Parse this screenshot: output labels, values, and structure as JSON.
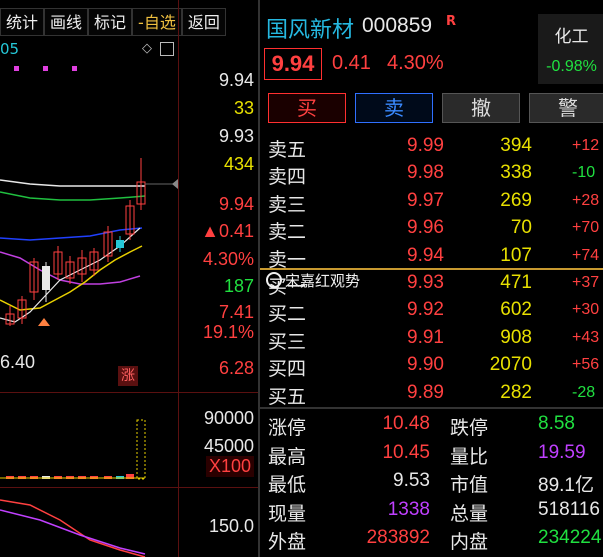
{
  "toolbar": {
    "items": [
      "统计",
      "画线",
      "标记",
      "-自选",
      "返回"
    ]
  },
  "chart_axis": {
    "top_code": "05",
    "price_right": [
      "9.94",
      "33",
      "9.93",
      "434",
      "9.94",
      "▲0.41",
      "4.30%",
      "187",
      "7.41",
      "19.1%",
      "6.28"
    ],
    "low_label": "6.40",
    "zhang": "涨",
    "volume_ticks": [
      "90000",
      "45000",
      "X100"
    ],
    "bottom_tick": "150.0"
  },
  "stock": {
    "name": "国风新材",
    "code": "000859",
    "badge": "R",
    "price": "9.94",
    "change": "0.41",
    "change_pct": "4.30%"
  },
  "sector": {
    "name": "化工",
    "change_pct": "-0.98%"
  },
  "actions": {
    "buy": "买",
    "sell": "卖",
    "cancel": "撤",
    "alert": "警"
  },
  "asks": [
    {
      "label": "卖五",
      "price": "9.99",
      "volume": "394",
      "delta": "+12",
      "delta_color": "#ff4040"
    },
    {
      "label": "卖四",
      "price": "9.98",
      "volume": "338",
      "delta": "-10",
      "delta_color": "#20e040"
    },
    {
      "label": "卖三",
      "price": "9.97",
      "volume": "269",
      "delta": "+28",
      "delta_color": "#ff4040"
    },
    {
      "label": "卖二",
      "price": "9.96",
      "volume": "70",
      "delta": "+70",
      "delta_color": "#ff4040"
    },
    {
      "label": "卖一",
      "price": "9.94",
      "volume": "107",
      "delta": "+74",
      "delta_color": "#ff4040"
    }
  ],
  "bids": [
    {
      "label": "买一",
      "price": "9.93",
      "volume": "471",
      "delta": "+37",
      "delta_color": "#ff4040"
    },
    {
      "label": "买二",
      "price": "9.92",
      "volume": "602",
      "delta": "+30",
      "delta_color": "#ff4040"
    },
    {
      "label": "买三",
      "price": "9.91",
      "volume": "908",
      "delta": "+43",
      "delta_color": "#ff4040"
    },
    {
      "label": "买四",
      "price": "9.90",
      "volume": "2070",
      "delta": "+56",
      "delta_color": "#ff4040"
    },
    {
      "label": "买五",
      "price": "9.89",
      "volume": "282",
      "delta": "-28",
      "delta_color": "#20e040"
    }
  ],
  "stats": [
    {
      "l1": "涨停",
      "v1": "10.48",
      "c1": "#ff4040",
      "l2": "跌停",
      "v2": "8.58",
      "c2": "#20e040"
    },
    {
      "l1": "最高",
      "v1": "10.45",
      "c1": "#ff4040",
      "l2": "量比",
      "v2": "19.59",
      "c2": "#c040ff"
    },
    {
      "l1": "最低",
      "v1": "9.53",
      "c1": "#e8e8e8",
      "l2": "市值",
      "v2": "89.1亿",
      "c2": "#e8e8e8"
    },
    {
      "l1": "现量",
      "v1": "1338",
      "c1": "#c040ff",
      "l2": "总量",
      "v2": "518116",
      "c2": "#e8e8e8"
    },
    {
      "l1": "外盘",
      "v1": "283892",
      "c1": "#ff4040",
      "l2": "内盘",
      "v2": "234224",
      "c2": "#20e040"
    }
  ],
  "watermark": "宋嘉红观势"
}
